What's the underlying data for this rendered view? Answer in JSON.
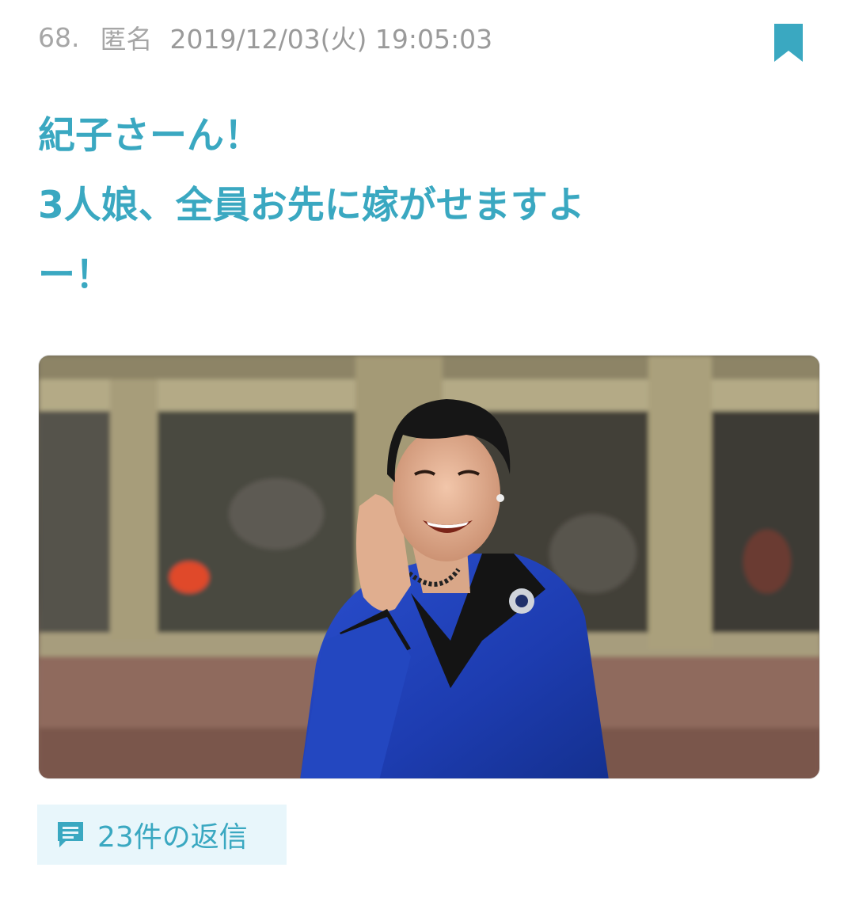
{
  "comment": {
    "number": "68.",
    "author": "匿名",
    "datetime": "2019/12/03(火) 19:05:03",
    "body_lines": [
      "紀子さーん！",
      "3人娘、全員お先に嫁がせますよ",
      "ー！"
    ]
  },
  "icons": {
    "bookmark": "bookmark-icon",
    "reply": "comment-icon"
  },
  "colors": {
    "accent": "#3aa8c1",
    "meta_text": "#a6a6a6",
    "reply_bg": "#e8f6fb"
  },
  "replies": {
    "label": "23件の返信"
  }
}
